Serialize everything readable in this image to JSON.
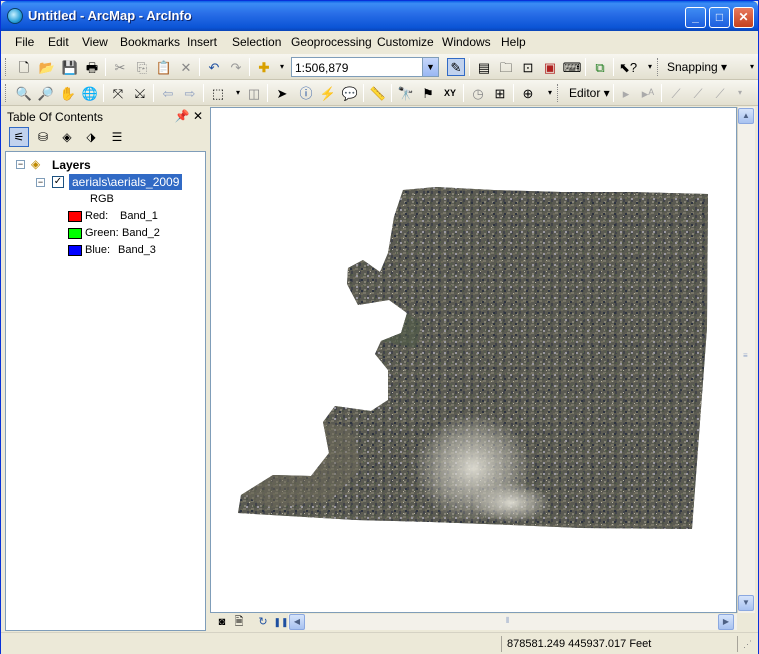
{
  "window": {
    "title": "Untitled - ArcMap - ArcInfo",
    "minimize": "_",
    "maximize": "□",
    "close": "✕"
  },
  "menu": [
    "File",
    "Edit",
    "View",
    "Bookmarks",
    "Insert",
    "Selection",
    "Geoprocessing",
    "Customize",
    "Windows",
    "Help"
  ],
  "toolbar": {
    "scale_value": "1:506,879",
    "snapping_label": "Snapping ▾",
    "editor_label": "Editor ▾",
    "xy_label": "XY"
  },
  "toc": {
    "title": "Table Of Contents",
    "pin": "ᵖ",
    "close": "✕",
    "group_label": "Layers",
    "layer_label": "aerials\\aerials_2009",
    "layer_checked": "✓",
    "rgb_label": "RGB",
    "bands": [
      {
        "label": "Red:",
        "value": "Band_1",
        "color": "#ff0000"
      },
      {
        "label": "Green:",
        "value": "Band_2",
        "color": "#00ff00"
      },
      {
        "label": "Blue:",
        "value": "Band_3",
        "color": "#0000ff"
      }
    ]
  },
  "status": {
    "coordinates": "878581.249  445937.017 Feet"
  },
  "colors": {
    "selection": "#316ac5",
    "title_blue": "#0b54d6"
  }
}
